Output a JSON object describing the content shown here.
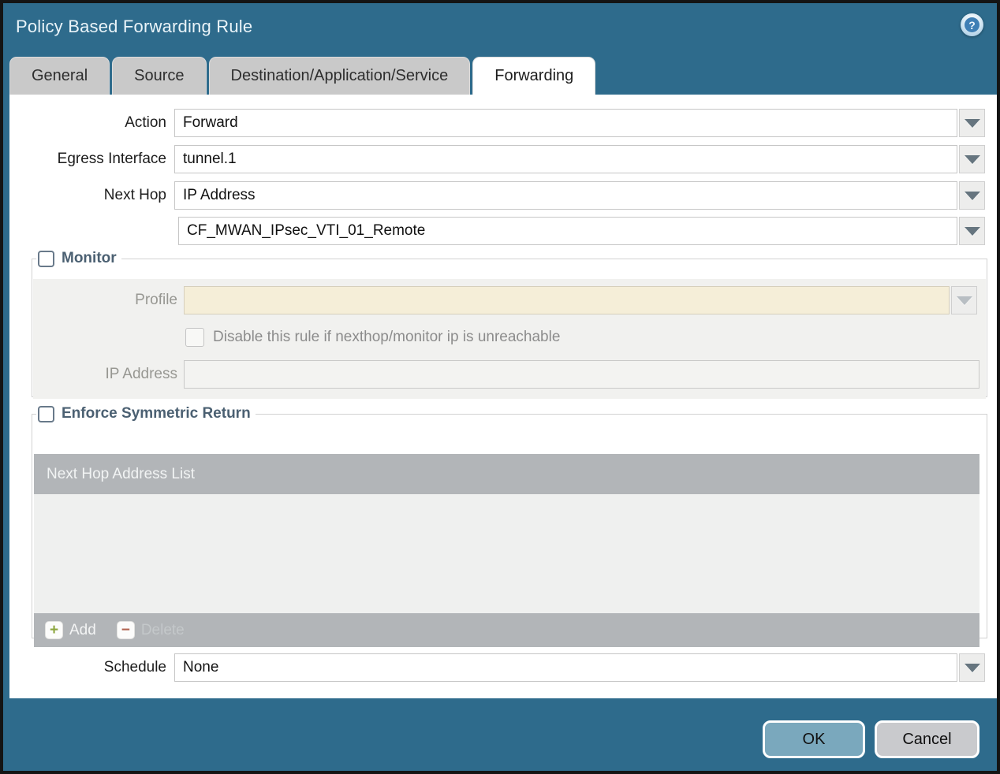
{
  "window": {
    "title": "Policy Based Forwarding Rule"
  },
  "icons": {
    "help": "help-icon",
    "dropdown": "chevron-down-icon",
    "add": "plus-icon",
    "delete": "minus-icon"
  },
  "glyphs": {
    "help": "?",
    "plus": "+",
    "minus": "−"
  },
  "tabs": [
    {
      "label": "General",
      "active": false
    },
    {
      "label": "Source",
      "active": false
    },
    {
      "label": "Destination/Application/Service",
      "active": false
    },
    {
      "label": "Forwarding",
      "active": true
    }
  ],
  "form": {
    "action": {
      "label": "Action",
      "value": "Forward"
    },
    "egress_interface": {
      "label": "Egress Interface",
      "value": "tunnel.1"
    },
    "next_hop": {
      "label": "Next Hop",
      "value": "IP Address"
    },
    "next_hop_address": {
      "value": "CF_MWAN_IPsec_VTI_01_Remote"
    },
    "schedule": {
      "label": "Schedule",
      "value": "None"
    }
  },
  "monitor": {
    "legend": "Monitor",
    "checked": false,
    "profile": {
      "label": "Profile",
      "value": ""
    },
    "disable_rule": {
      "label": "Disable this rule if nexthop/monitor ip is unreachable",
      "checked": false
    },
    "ip_address": {
      "label": "IP Address",
      "value": ""
    }
  },
  "symmetric_return": {
    "legend": "Enforce Symmetric Return",
    "checked": false,
    "table": {
      "header": "Next Hop Address List",
      "rows": []
    },
    "add_label": "Add",
    "delete_label": "Delete"
  },
  "footer": {
    "ok_label": "OK",
    "cancel_label": "Cancel"
  },
  "colors": {
    "titlebar_teal": "#2e6b8c",
    "tab_gray": "#c9c9c9",
    "table_bar_gray": "#b2b5b8",
    "table_body_gray": "#eff0ef",
    "panel_gray": "#f1f1ef",
    "profile_beige": "#f5eed8",
    "ok_button_blue": "#7aa8bd",
    "cancel_button_gray": "#c9cacd",
    "legend_slate": "#4b6072",
    "add_plus_green": "#8da63e",
    "delete_minus_red": "#b26450"
  }
}
